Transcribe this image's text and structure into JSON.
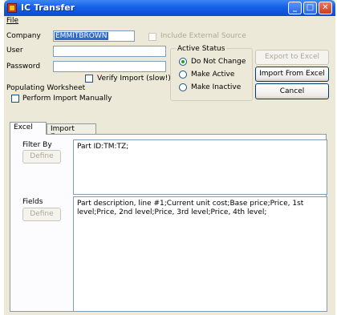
{
  "window": {
    "title": "IC Transfer",
    "minimize": "_",
    "maximize": "□",
    "close": "✕"
  },
  "menu": {
    "file": "File"
  },
  "form": {
    "company_label": "Company",
    "company_value": "EMMITBROWN",
    "include_external_source": "Include External Source",
    "user_label": "User",
    "user_value": "",
    "password_label": "Password",
    "password_value": "",
    "verify_import": "Verify Import (slow!)",
    "populating_worksheet": "Populating Worksheet",
    "perform_import_manually": "Perform Import Manually"
  },
  "active_status": {
    "legend": "Active Status",
    "options": [
      "Do Not Change",
      "Make Active",
      "Make Inactive"
    ],
    "selected": "Do Not Change"
  },
  "buttons": {
    "export": "Export to Excel",
    "import": "Import From Excel",
    "cancel": "Cancel"
  },
  "tabs": [
    "Excel",
    "Import Errors"
  ],
  "excel_tab": {
    "filter_label": "Filter By",
    "filter_define": "Define",
    "filter_value": "Part ID:TM:TZ;",
    "fields_label": "Fields",
    "fields_define": "Define",
    "fields_value": "Part description, line #1;Current unit cost;Base price;Price, 1st level;Price, 2nd level;Price, 3rd level;Price, 4th level;"
  }
}
